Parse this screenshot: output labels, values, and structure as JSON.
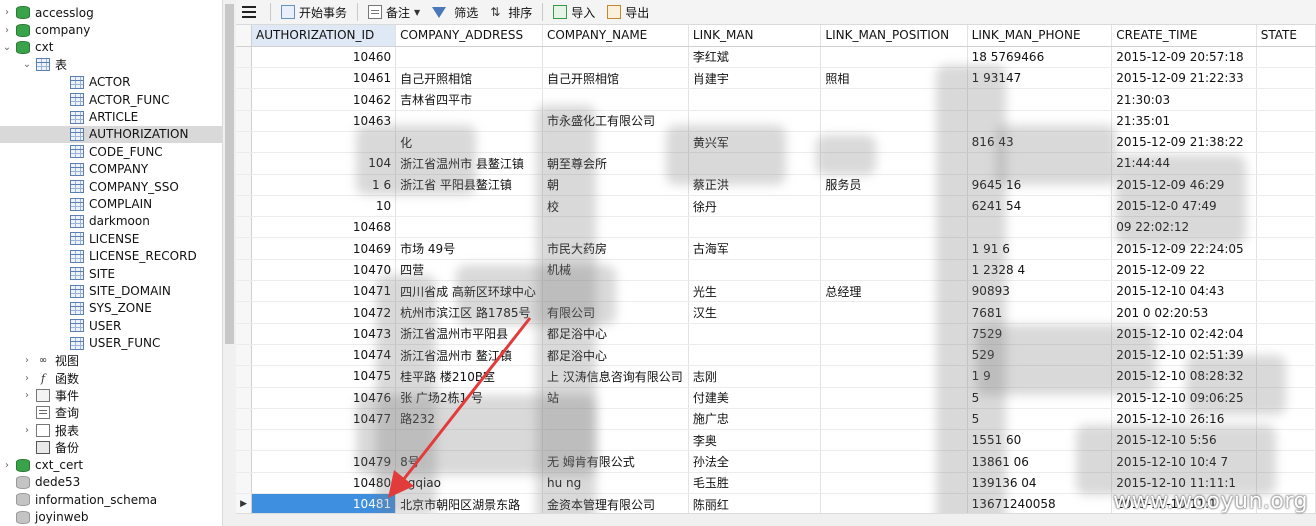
{
  "sidebar": {
    "items": [
      {
        "label": "accesslog",
        "icon": "database-icon",
        "level": 0,
        "twisty": "›"
      },
      {
        "label": "company",
        "icon": "database-icon",
        "level": 0,
        "twisty": "›"
      },
      {
        "label": "cxt",
        "icon": "database-icon",
        "level": 0,
        "twisty": "⌄"
      },
      {
        "label": "表",
        "icon": "tables-folder-icon",
        "level": 1,
        "twisty": "⌄"
      },
      {
        "label": "ACTOR",
        "icon": "table-icon",
        "level": 2
      },
      {
        "label": "ACTOR_FUNC",
        "icon": "table-icon",
        "level": 2
      },
      {
        "label": "ARTICLE",
        "icon": "table-icon",
        "level": 2
      },
      {
        "label": "AUTHORIZATION",
        "icon": "table-icon",
        "level": 2,
        "selected": true
      },
      {
        "label": "CODE_FUNC",
        "icon": "table-icon",
        "level": 2
      },
      {
        "label": "COMPANY",
        "icon": "table-icon",
        "level": 2
      },
      {
        "label": "COMPANY_SSO",
        "icon": "table-icon",
        "level": 2
      },
      {
        "label": "COMPLAIN",
        "icon": "table-icon",
        "level": 2
      },
      {
        "label": "darkmoon",
        "icon": "table-icon",
        "level": 2
      },
      {
        "label": "LICENSE",
        "icon": "table-icon",
        "level": 2
      },
      {
        "label": "LICENSE_RECORD",
        "icon": "table-icon",
        "level": 2
      },
      {
        "label": "SITE",
        "icon": "table-icon",
        "level": 2
      },
      {
        "label": "SITE_DOMAIN",
        "icon": "table-icon",
        "level": 2
      },
      {
        "label": "SYS_ZONE",
        "icon": "table-icon",
        "level": 2
      },
      {
        "label": "USER",
        "icon": "table-icon",
        "level": 2
      },
      {
        "label": "USER_FUNC",
        "icon": "table-icon",
        "level": 2
      },
      {
        "label": "视图",
        "icon": "view-icon",
        "level": 1,
        "twisty": "›"
      },
      {
        "label": "函数",
        "icon": "function-icon",
        "level": 1,
        "twisty": "›"
      },
      {
        "label": "事件",
        "icon": "event-icon",
        "level": 1,
        "twisty": "›"
      },
      {
        "label": "查询",
        "icon": "query-icon",
        "level": 1
      },
      {
        "label": "报表",
        "icon": "report-icon",
        "level": 1,
        "twisty": "›"
      },
      {
        "label": "备份",
        "icon": "backup-icon",
        "level": 1
      },
      {
        "label": "cxt_cert",
        "icon": "database-icon",
        "level": 0,
        "twisty": "›"
      },
      {
        "label": "dede53",
        "icon": "database-gray-icon",
        "level": 0
      },
      {
        "label": "information_schema",
        "icon": "database-gray-icon",
        "level": 0
      },
      {
        "label": "joyinweb",
        "icon": "database-gray-icon",
        "level": 0
      }
    ]
  },
  "toolbar": {
    "begin_transaction": "开始事务",
    "note": "备注",
    "filter": "筛选",
    "sort": "排序",
    "import": "导入",
    "export": "导出"
  },
  "grid": {
    "columns": [
      "AUTHORIZATION_ID",
      "COMPANY_ADDRESS",
      "COMPANY_NAME",
      "LINK_MAN",
      "LINK_MAN_POSITION",
      "LINK_MAN_PHONE",
      "CREATE_TIME",
      "STATE"
    ],
    "rows": [
      [
        "10460",
        "",
        "",
        "李红斌",
        "",
        "18   5769466",
        "2015-12-09 20:57:18",
        ""
      ],
      [
        "10461",
        "自己开照相馆",
        "自己开照相馆",
        "肖建宇",
        "照相",
        "1     93147",
        "2015-12-09 21:22:33",
        ""
      ],
      [
        "10462",
        "吉林省四平市",
        "",
        "",
        "",
        "",
        "     21:30:03",
        ""
      ],
      [
        "10463",
        "",
        "   市永盛化工有限公司",
        "",
        "",
        "",
        "     21:35:01",
        ""
      ],
      [
        "",
        "   化",
        "",
        "黄兴军",
        "",
        "   816   43",
        "2015-12-09 21:38:22",
        ""
      ],
      [
        "104",
        "浙江省温州市   县鳌江镇",
        "   朝至尊会所",
        "",
        "",
        "",
        "       21:44:44",
        ""
      ],
      [
        "1   6",
        "浙江省   平阳县鳌江镇",
        "   朝",
        "蔡正洪",
        "服务员",
        "   9645   16",
        "2015-12-09   46:29",
        ""
      ],
      [
        "10   ",
        "",
        "   校",
        "徐丹",
        "",
        "   6241   54",
        "2015-12-0   47:49",
        ""
      ],
      [
        "10468",
        "",
        "",
        "",
        "",
        "",
        "   09 22:02:12",
        ""
      ],
      [
        "10469",
        "市场   49号",
        "   市民大药房",
        "古海军",
        "",
        "1   91   6",
        "2015-12-09 22:24:05",
        ""
      ],
      [
        "10470",
        "四营",
        "   机械",
        "",
        "",
        "1   2328   4",
        "2015-12-09 22   ",
        ""
      ],
      [
        "10471",
        "四川省成   高新区环球中心",
        "",
        "   光生",
        "总经理",
        "   90893",
        "2015-12-10   04:43",
        ""
      ],
      [
        "10472",
        "杭州市滨江区   路1785号",
        "   有限公司",
        "   汉生",
        "",
        "   7681",
        "201   0 02:20:53",
        ""
      ],
      [
        "10473",
        "浙江省温州市平阳县",
        "   都足浴中心",
        "",
        "",
        "   7529",
        "2015-12-10 02:42:04",
        ""
      ],
      [
        "10474",
        "浙江省温州市   鳌江镇",
        "   都足浴中心",
        "",
        "",
        "   529",
        "2015-12-10 02:51:39",
        ""
      ],
      [
        "10475",
        "桂平路   楼210B室",
        "上   汉涛信息咨询有限公司",
        "   志刚",
        "",
        "   1   9",
        "2015-12-10 08:28:32",
        ""
      ],
      [
        "10476",
        "张   广场2栋1   号",
        "   站",
        "付建美",
        "",
        "   5",
        "2015-12-10 09:06:25",
        ""
      ],
      [
        "10477",
        "   路232",
        "",
        "施广忠",
        "",
        "   5",
        "2015-12-10   26:16",
        ""
      ],
      [
        "",
        "",
        "",
        "李奥",
        "",
        "1551   60",
        "2015-12-10   5:56",
        ""
      ],
      [
        "10479",
        "   8号",
        "无   姆肯有限公式",
        "孙法全",
        "",
        "13861   06",
        "2015-12-10 10:4   7",
        ""
      ],
      [
        "10480",
        "   ngqiao",
        "hu   ng",
        "毛玉胜",
        "",
        "139136   04",
        "2015-12-10 11:11:1   ",
        ""
      ],
      [
        "10481",
        "北京市朝阳区湖景东路",
        "   金资本管理有限公司",
        "陈丽红",
        "",
        "13671240058",
        "2015-12-10 11:1",
        ""
      ]
    ],
    "current_row_marker": "▶"
  },
  "watermark": "www.wooyun.org",
  "colors": {
    "selection": "#3e8fe0",
    "arrow": "#e23b3b",
    "db_icon": "#3aa24a"
  }
}
